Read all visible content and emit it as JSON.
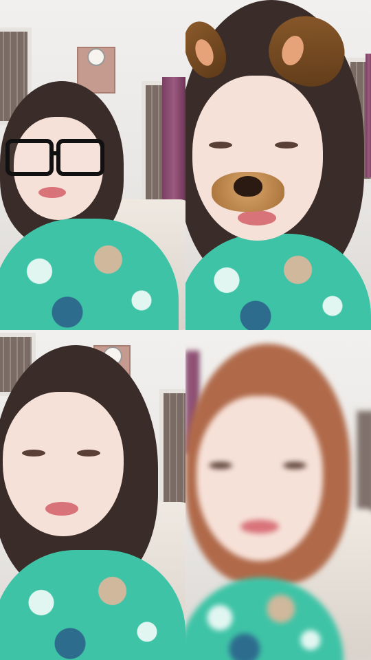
{
  "collage": {
    "panels": [
      {
        "filter": "glasses-icon"
      },
      {
        "filter": "dog-ears-icon"
      },
      {
        "filter": "none"
      },
      {
        "filter": "red-hair"
      }
    ]
  },
  "colors": {
    "shirt": "#3ec3a6",
    "wall": "#ecebe9",
    "curtain": "#8a4a70"
  }
}
